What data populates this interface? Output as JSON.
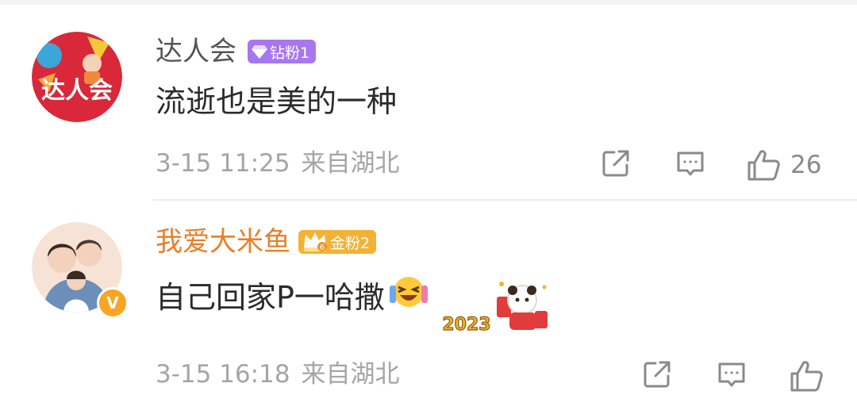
{
  "comments": [
    {
      "username": "达人会",
      "badge": "钻粉1",
      "badge_color": "#a777ee",
      "text": "流逝也是美的一种",
      "time": "3-15 11:25",
      "location": "来自湖北",
      "likes": "26",
      "avatar_text": "达人会",
      "actions": [
        "share-icon",
        "reply-icon",
        "like-icon"
      ]
    },
    {
      "username": "我爱大米鱼",
      "badge": "金粉2",
      "badge_level": "6",
      "badge_color": "#f3b236",
      "username_color": "#e87f28",
      "text": "自己回家P一哈撒",
      "time": "3-15 16:18",
      "location": "来自湖北",
      "sticker_text": "2023",
      "verified": "V",
      "actions": [
        "share-icon",
        "reply-icon",
        "like-icon"
      ]
    }
  ]
}
